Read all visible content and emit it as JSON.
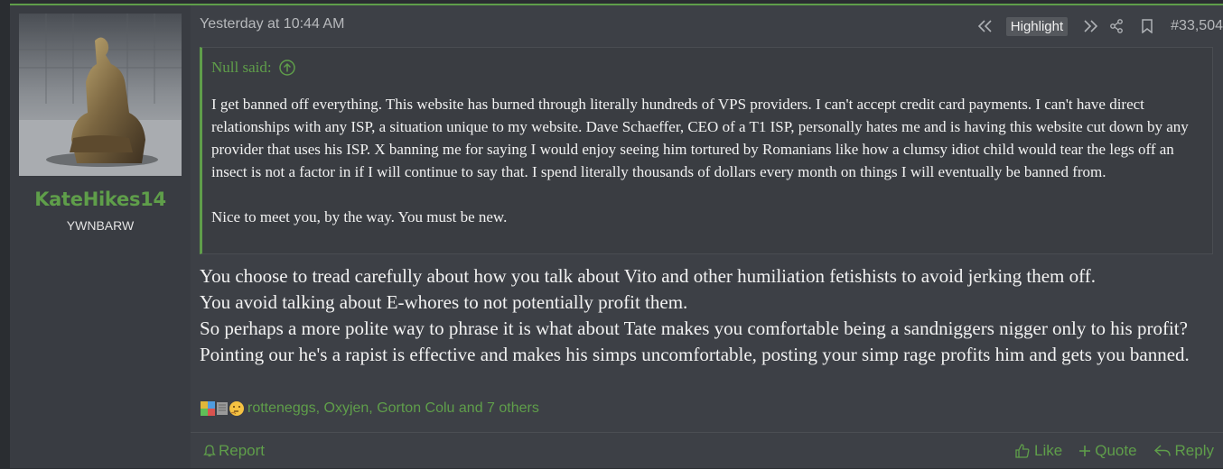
{
  "user": {
    "name": "KateHikes14",
    "title": "YWNBARW",
    "avatar_icon": "statue-avatar"
  },
  "post": {
    "timestamp": "Yesterday at 10:44 AM",
    "highlight_label": "Highlight",
    "post_number": "#33,504"
  },
  "quote": {
    "author_line": "Null said:",
    "paragraphs": [
      "I get banned off everything. This website has burned through literally hundreds of VPS providers. I can't accept credit card payments. I can't have direct relationships with any ISP, a situation unique to my website. Dave Schaeffer, CEO of a T1 ISP, personally hates me and is having this website cut down by any provider that uses his ISP. X banning me for saying I would enjoy seeing him tortured by Romanians like how a clumsy idiot child would tear the legs off an insect is not a factor in if I will continue to say that. I spend literally thousands of dollars every month on things I will eventually be banned from.",
      "Nice to meet you, by the way. You must be new."
    ]
  },
  "body": {
    "lines": [
      "You choose to tread carefully about how you talk about Vito and other humiliation fetishists to avoid jerking them off.",
      "You avoid talking about E-whores to not potentially profit them.",
      "So perhaps a more polite way to phrase it is what about Tate makes you comfortable being a sandniggers nigger only to his profit? Pointing our he's a rapist is effective and makes his simps uncomfortable, posting your simp rage profits him and gets you banned."
    ]
  },
  "reactions": {
    "icons": [
      "puzzle-icon",
      "scroll-icon",
      "thinking-face-icon"
    ],
    "text": "rotteneggs, Oxyjen, Gorton Colu and 7 others"
  },
  "footer": {
    "report": "Report",
    "like": "Like",
    "quote": "Quote",
    "reply": "Reply"
  },
  "colors": {
    "accent": "#5f9e4a",
    "background": "#3d4046",
    "text": "#f2f2f2"
  }
}
